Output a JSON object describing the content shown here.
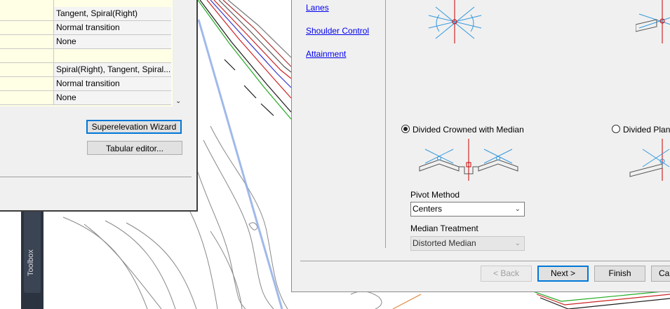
{
  "properties": {
    "rows": [
      {
        "value": ""
      },
      {
        "value": "Tangent, Spiral(Right)"
      },
      {
        "value": "Normal transition"
      },
      {
        "value": "None"
      },
      {
        "value": ""
      },
      {
        "value": "Spiral(Right), Tangent, Spiral..."
      },
      {
        "value": "Normal transition"
      },
      {
        "value": "None"
      }
    ],
    "superelevation_wizard_label": "Superelevation Wizard",
    "tabular_editor_label": "Tabular editor..."
  },
  "toolbox": {
    "label": "Toolbox"
  },
  "wizard": {
    "nav": [
      "Lanes",
      "Shoulder Control",
      "Attainment"
    ],
    "option_divided_crowned": "Divided Crowned with Median",
    "option_divided_planar": "Divided Planar",
    "pivot_method_label": "Pivot Method",
    "pivot_method_value": "Centers",
    "median_treatment_label": "Median Treatment",
    "median_treatment_value": "Distorted Median",
    "buttons": {
      "back": "< Back",
      "next": "Next >",
      "finish": "Finish",
      "cancel": "Cancel"
    }
  },
  "colors": {
    "accent": "#0078d7",
    "link": "#0000ee",
    "toolbox_bg": "#3b4453",
    "pivot_red": "#cc0000"
  },
  "icons": [
    "chevron-down-icon",
    "pivot-diagram-icon"
  ]
}
